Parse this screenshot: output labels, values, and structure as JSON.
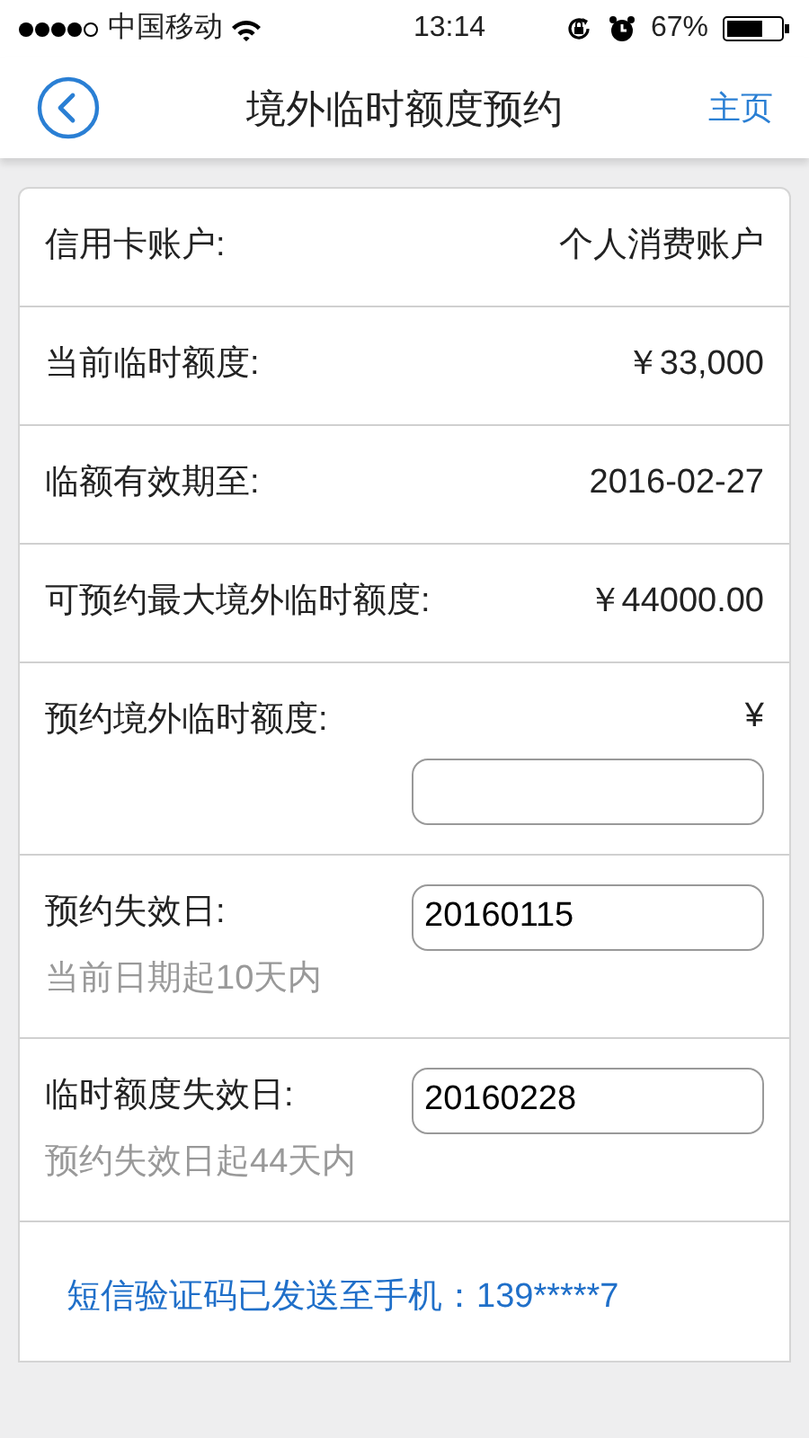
{
  "status_bar": {
    "carrier": "中国移动",
    "time": "13:14",
    "battery": "67%"
  },
  "header": {
    "title": "境外临时额度预约",
    "home": "主页"
  },
  "rows": [
    {
      "kind": "info",
      "label": "信用卡账户:",
      "value": "个人消费账户"
    },
    {
      "kind": "info",
      "label": "当前临时额度:",
      "value": "￥33,000"
    },
    {
      "kind": "info",
      "label": "临额有效期至:",
      "value": "2016-02-27"
    },
    {
      "kind": "info",
      "label": "可预约最大境外临时额度:",
      "value": "￥44000.00"
    },
    {
      "kind": "input",
      "label": "预约境外临时额度:",
      "currency": "¥"
    },
    {
      "kind": "input",
      "label": "预约失效日:",
      "value": "20160115",
      "hint": "当前日期起10天内"
    },
    {
      "kind": "input",
      "label": "临时额度失效日:",
      "value": "20160228",
      "hint": "预约失效日起44天内"
    },
    {
      "kind": "notice",
      "text": "短信验证码已发送至手机：139*****7"
    }
  ]
}
